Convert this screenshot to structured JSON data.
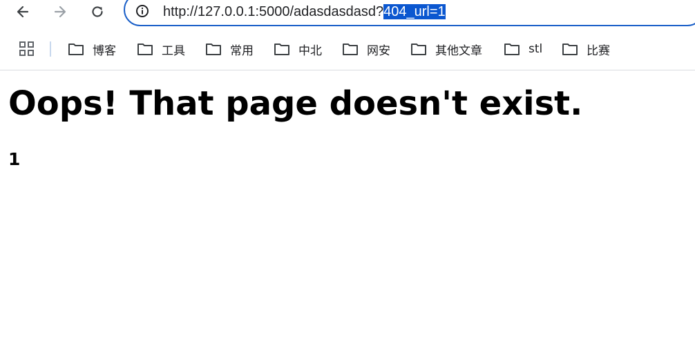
{
  "browser": {
    "nav": {
      "back_icon": "arrow-left-icon",
      "forward_icon": "arrow-right-icon",
      "reload_icon": "reload-icon"
    },
    "address_bar": {
      "url_prefix": "http://127.0.0.1:5000/adasdasdasd?",
      "url_selected": "404_url=1",
      "info_icon": "info-icon",
      "focus_color": "#1a5fc8",
      "selection_color": "#0b57d0"
    },
    "bookmarks": {
      "apps_icon": "apps-grid-icon",
      "items": [
        {
          "label": "博客",
          "icon": "folder-icon"
        },
        {
          "label": "工具",
          "icon": "folder-icon"
        },
        {
          "label": "常用",
          "icon": "folder-icon"
        },
        {
          "label": "中北",
          "icon": "folder-icon"
        },
        {
          "label": "网安",
          "icon": "folder-icon"
        },
        {
          "label": "其他文章",
          "icon": "folder-icon"
        },
        {
          "label": "stl",
          "icon": "folder-icon"
        },
        {
          "label": "比赛",
          "icon": "folder-icon"
        }
      ]
    }
  },
  "page": {
    "heading": "Oops! That page doesn't exist.",
    "subheading": "1"
  }
}
